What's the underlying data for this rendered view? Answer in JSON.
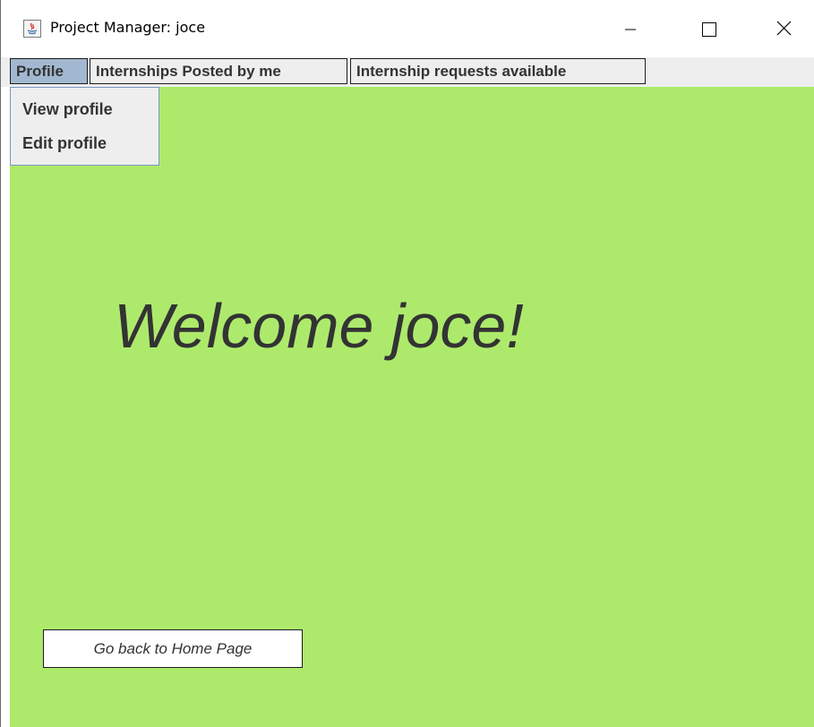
{
  "window": {
    "title": "Project Manager: joce"
  },
  "menubar": {
    "items": [
      {
        "label": "Profile"
      },
      {
        "label": "Internships Posted by me"
      },
      {
        "label": "Internship requests available"
      }
    ]
  },
  "dropdown": {
    "items": [
      {
        "label": "View profile"
      },
      {
        "label": "Edit profile"
      }
    ]
  },
  "main": {
    "welcome": "Welcome joce!",
    "home_button_label": "Go back to Home Page"
  },
  "colors": {
    "content_background": "#adea6c",
    "menu_selected": "#a2b8d0",
    "menubar_background": "#eeeeee",
    "text": "#333333"
  },
  "icons": {
    "app": "java-app-icon",
    "minimize": "minimize-icon",
    "maximize": "maximize-icon",
    "close": "close-icon"
  }
}
